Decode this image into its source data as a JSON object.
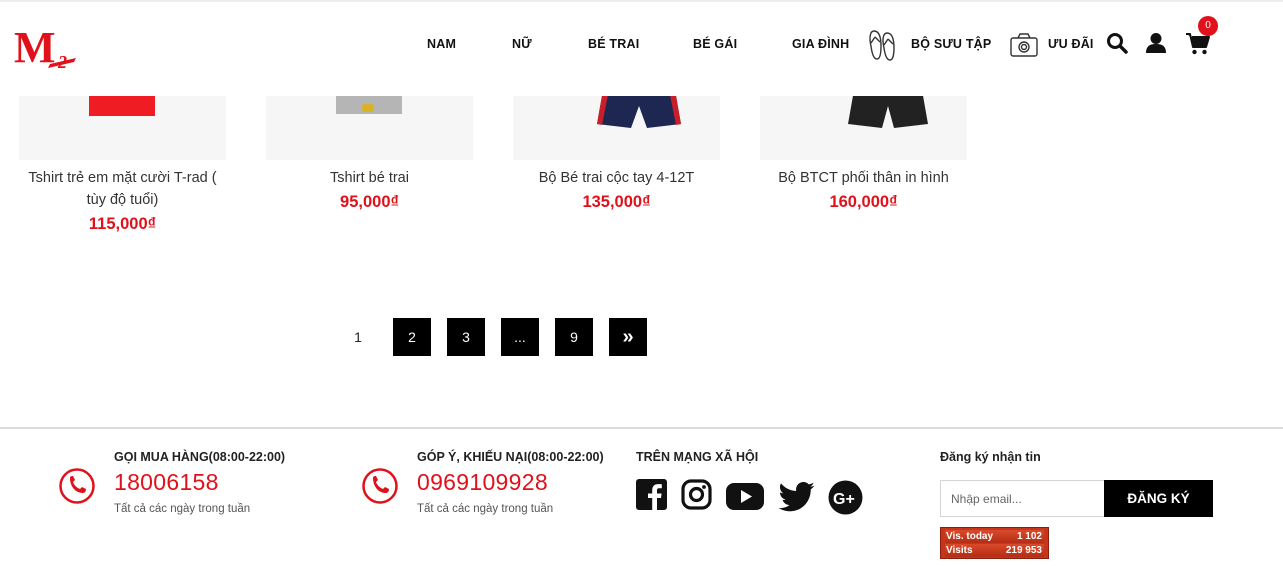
{
  "header": {
    "logo_text": "M2",
    "nav": [
      "NAM",
      "NỮ",
      "BÉ TRAI",
      "BÉ GÁI",
      "GIA ĐÌNH",
      "BỘ SƯU TẬP",
      "ƯU ĐÃI"
    ],
    "cart_count": "0"
  },
  "products": [
    {
      "name": "Tshirt trẻ em mặt cười T-rad ( tùy độ tuổi)",
      "price": "115,000₫"
    },
    {
      "name": "Tshirt bé trai",
      "price": "95,000₫"
    },
    {
      "name": "Bộ Bé trai cộc tay 4-12T",
      "price": "135,000₫"
    },
    {
      "name": "Bộ BTCT phối thân in hình",
      "price": "160,000₫"
    }
  ],
  "pagination": {
    "current": "1",
    "pages": [
      "2",
      "3",
      "...",
      "9"
    ],
    "next": "»"
  },
  "footer": {
    "order": {
      "title": "GỌI MUA HÀNG(08:00-22:00)",
      "phone": "18006158",
      "sub": "Tất cả các ngày trong tuần"
    },
    "feedback": {
      "title": "GÓP Ý, KHIẾU NẠI(08:00-22:00)",
      "phone": "0969109928",
      "sub": "Tất cả các ngày trong tuần"
    },
    "social_title": "TRÊN MẠNG XÃ HỘI",
    "social_icons": [
      "facebook-icon",
      "instagram-icon",
      "youtube-icon",
      "twitter-icon",
      "google-plus-icon"
    ],
    "newsletter": {
      "title": "Đăng ký nhận tin",
      "placeholder": "Nhập email...",
      "button": "ĐĂNG KÝ"
    },
    "counter": {
      "today_label": "Vis. today",
      "today_value": "1 102",
      "visits_label": "Visits",
      "visits_value": "219 953"
    }
  },
  "colors": {
    "accent": "#e0111b",
    "dark": "#000000"
  }
}
